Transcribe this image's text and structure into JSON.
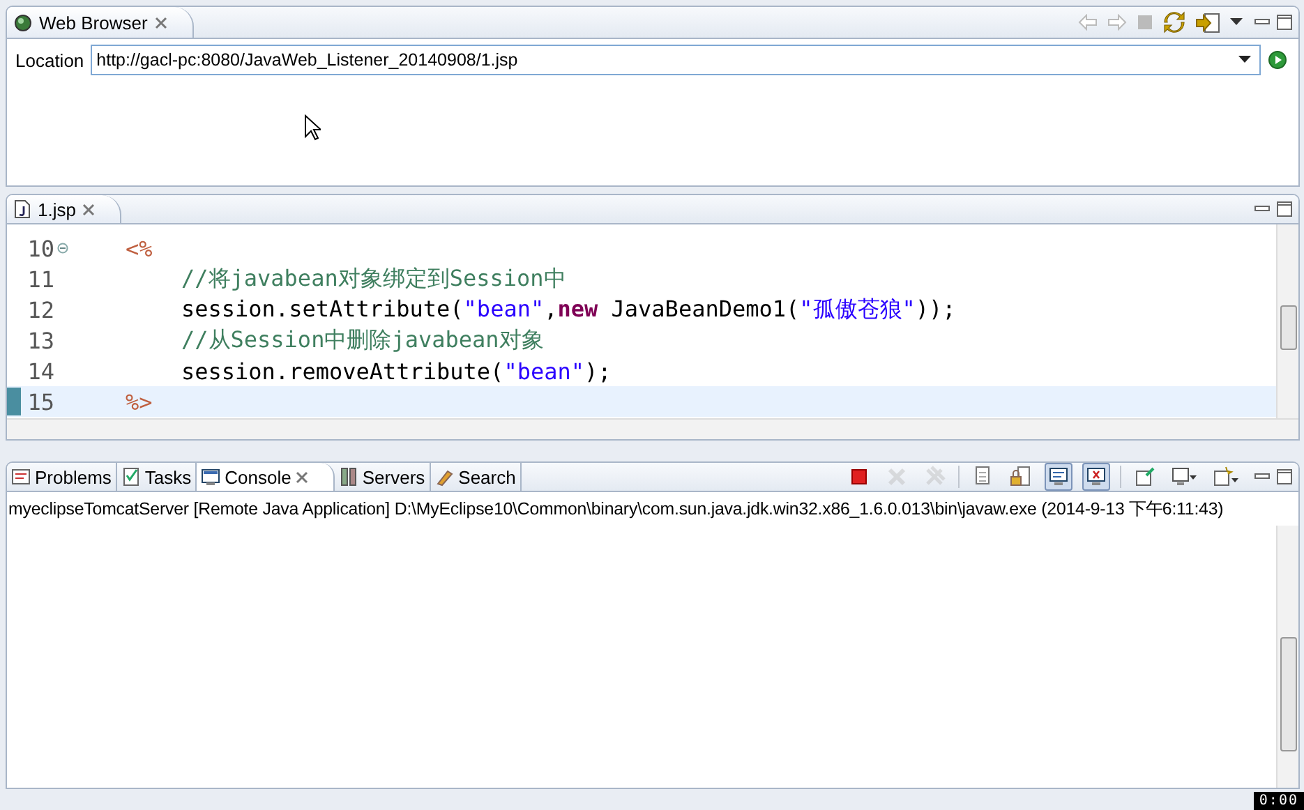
{
  "browser": {
    "tab": {
      "label": "Web Browser",
      "selected": true
    },
    "toolbar": [
      {
        "kind": "back",
        "disabled": true
      },
      {
        "kind": "forward",
        "disabled": true
      },
      {
        "kind": "stop",
        "disabled": true
      },
      {
        "kind": "refresh",
        "disabled": false
      },
      {
        "kind": "open",
        "disabled": false
      },
      {
        "kind": "menu",
        "disabled": false
      }
    ],
    "location_label": "Location",
    "url": "http://gacl-pc:8080/JavaWeb_Listener_20140908/1.jsp"
  },
  "editor": {
    "tab": {
      "label": "1.jsp",
      "selected": true
    },
    "lines": [
      {
        "number": "10",
        "kind": "delimiter",
        "fold": true,
        "current": false,
        "tokens": [
          {
            "kind": "tag",
            "text": "<%"
          }
        ]
      },
      {
        "number": "11",
        "kind": "statement",
        "fold": false,
        "current": false,
        "tokens": [
          {
            "kind": "comment",
            "text": "//将javabean对象绑定到Session中"
          }
        ]
      },
      {
        "number": "12",
        "kind": "statement",
        "fold": false,
        "current": false,
        "tokens": [
          {
            "kind": "plain",
            "text": "session.setAttribute("
          },
          {
            "kind": "string",
            "text": "\"bean\""
          },
          {
            "kind": "plain",
            "text": ","
          },
          {
            "kind": "keyword",
            "text": "new"
          },
          {
            "kind": "plain",
            "text": " JavaBeanDemo1("
          },
          {
            "kind": "string",
            "text": "\"孤傲苍狼\""
          },
          {
            "kind": "plain",
            "text": "));"
          }
        ]
      },
      {
        "number": "13",
        "kind": "statement",
        "fold": false,
        "current": false,
        "tokens": [
          {
            "kind": "comment",
            "text": "//从Session中删除javabean对象"
          }
        ]
      },
      {
        "number": "14",
        "kind": "statement",
        "fold": false,
        "current": false,
        "tokens": [
          {
            "kind": "plain",
            "text": "session.removeAttribute("
          },
          {
            "kind": "string",
            "text": "\"bean\""
          },
          {
            "kind": "plain",
            "text": ");"
          }
        ]
      },
      {
        "number": "15",
        "kind": "delimiter",
        "fold": false,
        "current": true,
        "tokens": [
          {
            "kind": "tag",
            "text": "%>"
          }
        ]
      }
    ]
  },
  "console": {
    "tabs": [
      {
        "label": "Problems",
        "kind": "problems",
        "selected": false,
        "closable": false
      },
      {
        "label": "Tasks",
        "kind": "tasks",
        "selected": false,
        "closable": false
      },
      {
        "label": "Console",
        "kind": "console",
        "selected": true,
        "closable": true
      },
      {
        "label": "Servers",
        "kind": "servers",
        "selected": false,
        "closable": false
      },
      {
        "label": "Search",
        "kind": "search",
        "selected": false,
        "closable": false
      }
    ],
    "toolbar": [
      {
        "kind": "terminate",
        "disabled": false,
        "pressed": false
      },
      {
        "kind": "remove",
        "disabled": true,
        "pressed": false
      },
      {
        "kind": "remove-all",
        "disabled": true,
        "pressed": false
      },
      {
        "kind": "sep"
      },
      {
        "kind": "clear",
        "disabled": false,
        "pressed": false
      },
      {
        "kind": "lock",
        "disabled": false,
        "pressed": false
      },
      {
        "kind": "stdout",
        "disabled": false,
        "pressed": true
      },
      {
        "kind": "stderr",
        "disabled": false,
        "pressed": true
      },
      {
        "kind": "sep"
      },
      {
        "kind": "pin",
        "disabled": false,
        "pressed": false
      },
      {
        "kind": "display",
        "disabled": false,
        "pressed": false
      },
      {
        "kind": "new",
        "disabled": false,
        "pressed": false
      }
    ],
    "header": "myeclipseTomcatServer [Remote Java Application] D:\\MyEclipse10\\Common\\binary\\com.sun.java.jdk.win32.x86_1.6.0.013\\bin\\javaw.exe (2014-9-13 下午6:11:43)"
  },
  "timer": "0:00"
}
